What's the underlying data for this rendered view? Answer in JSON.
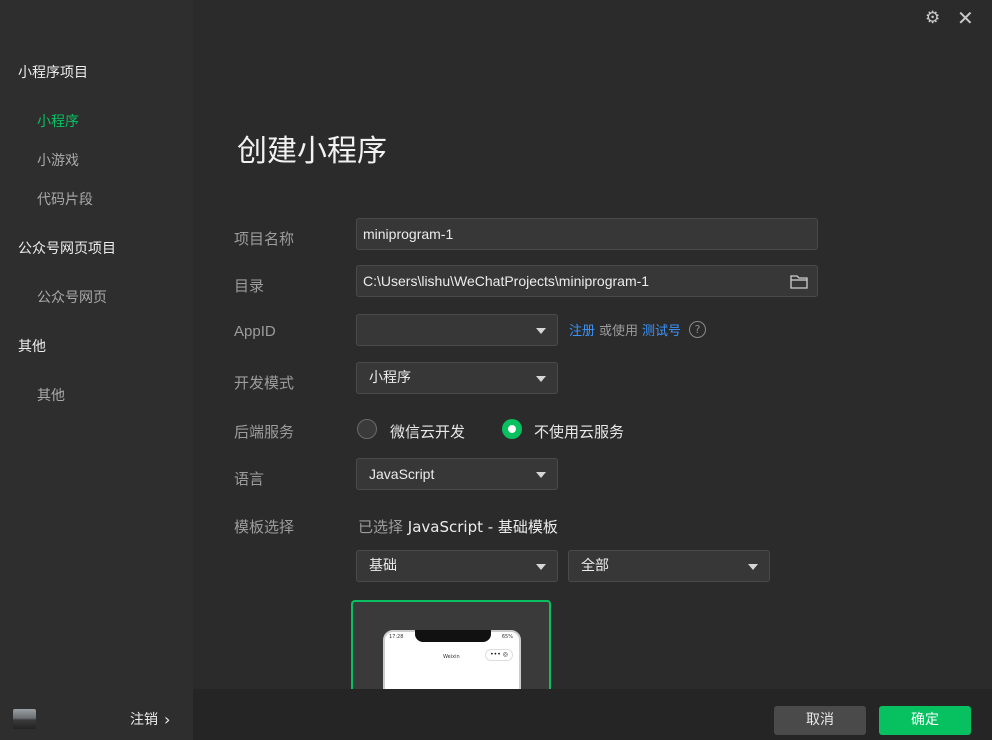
{
  "sidebar": {
    "groups": [
      {
        "label": "小程序项目",
        "items": [
          "小程序",
          "小游戏",
          "代码片段"
        ]
      },
      {
        "label": "公众号网页项目",
        "items": [
          "公众号网页"
        ]
      },
      {
        "label": "其他",
        "items": [
          "其他"
        ]
      }
    ],
    "active_item": "小程序",
    "logout_label": "注销",
    "logout_chevron": "›"
  },
  "window": {
    "settings_icon": "⚙",
    "close_icon": "✕"
  },
  "form": {
    "title": "创建小程序",
    "project_name": {
      "label": "项目名称",
      "value": "miniprogram-1"
    },
    "directory": {
      "label": "目录",
      "value": "C:\\Users\\lishu\\WeChatProjects\\miniprogram-1"
    },
    "appid": {
      "label": "AppID",
      "value": "",
      "register_link": "注册",
      "or_use": "或使用",
      "test_link": "测试号",
      "help_icon": "?"
    },
    "dev_mode": {
      "label": "开发模式",
      "value": "小程序"
    },
    "backend": {
      "label": "后端服务",
      "options": [
        "微信云开发",
        "不使用云服务"
      ],
      "selected": "不使用云服务"
    },
    "language": {
      "label": "语言",
      "value": "JavaScript"
    },
    "template": {
      "label": "模板选择",
      "selected_prefix": "已选择",
      "selected_value": "JavaScript - 基础模板",
      "category": "基础",
      "filter": "全部",
      "preview": {
        "time": "17:28",
        "battery": "65%",
        "title": "Weixin",
        "capsule": "••• ◎"
      }
    }
  },
  "footer": {
    "cancel_label": "取消",
    "confirm_label": "确定"
  },
  "colors": {
    "accent": "#07c160",
    "link": "#3a95ff",
    "sidebar_bg": "#2e2e2e",
    "main_bg": "#2b2b2b"
  }
}
